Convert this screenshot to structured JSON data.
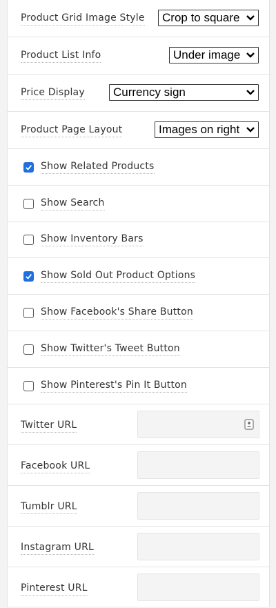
{
  "selects": [
    {
      "label": "Product Grid Image Style",
      "value": "Crop to square"
    },
    {
      "label": "Product List Info",
      "value": "Under image"
    },
    {
      "label": "Price Display",
      "value": "Currency sign"
    },
    {
      "label": "Product Page Layout",
      "value": "Images on right"
    }
  ],
  "checkboxes": [
    {
      "label": "Show Related Products",
      "checked": true
    },
    {
      "label": "Show Search",
      "checked": false
    },
    {
      "label": "Show Inventory Bars",
      "checked": false
    },
    {
      "label": "Show Sold Out Product Options",
      "checked": true
    },
    {
      "label": "Show Facebook's Share Button",
      "checked": false
    },
    {
      "label": "Show Twitter's Tweet Button",
      "checked": false
    },
    {
      "label": "Show Pinterest's Pin It Button",
      "checked": false
    }
  ],
  "urls": [
    {
      "label": "Twitter URL",
      "value": ""
    },
    {
      "label": "Facebook URL",
      "value": ""
    },
    {
      "label": "Tumblr URL",
      "value": ""
    },
    {
      "label": "Instagram URL",
      "value": ""
    },
    {
      "label": "Pinterest URL",
      "value": ""
    }
  ],
  "colors": {
    "checkbox_checked": "#1e6fe0",
    "input_bg": "#f4f4f4"
  },
  "icons": {
    "select_arrow": "chevron-down-icon",
    "check": "check-icon",
    "autofill": "contact-card-icon"
  }
}
